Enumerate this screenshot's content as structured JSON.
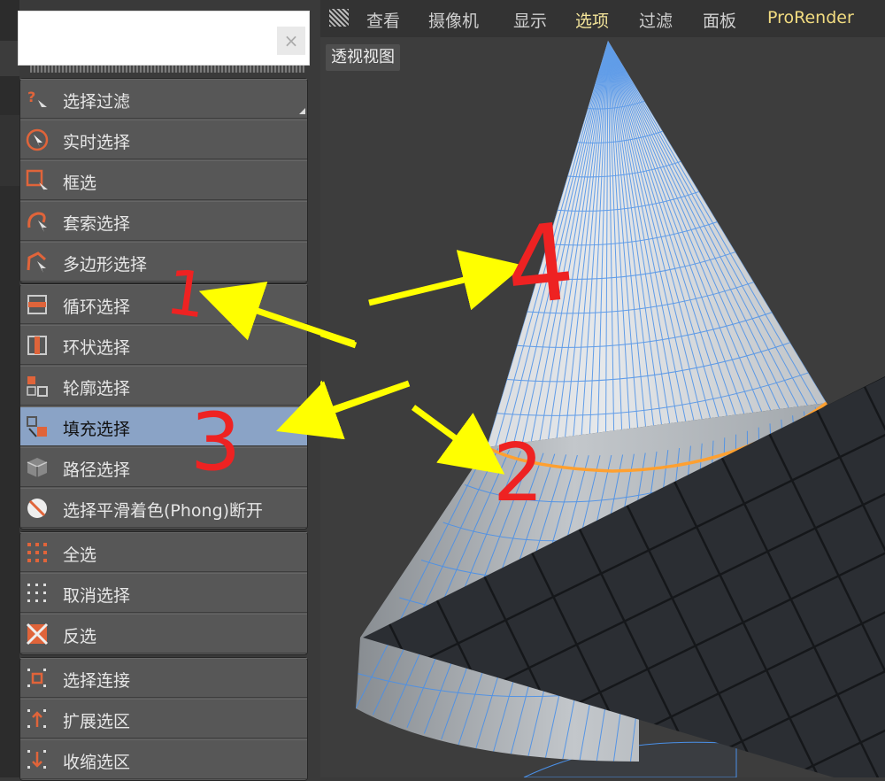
{
  "menu": {
    "groups": [
      {
        "items": [
          {
            "label": "选择过滤",
            "icon": "question-cursor-icon"
          },
          {
            "label": "实时选择",
            "icon": "live-select-icon"
          },
          {
            "label": "框选",
            "icon": "rectangle-select-icon"
          },
          {
            "label": "套索选择",
            "icon": "lasso-select-icon"
          },
          {
            "label": "多边形选择",
            "icon": "polygon-select-icon"
          }
        ]
      },
      {
        "items": [
          {
            "label": "循环选择",
            "icon": "loop-select-icon"
          },
          {
            "label": "环状选择",
            "icon": "ring-select-icon"
          },
          {
            "label": "轮廓选择",
            "icon": "outline-select-icon"
          },
          {
            "label": "填充选择",
            "icon": "fill-select-icon",
            "active": true
          },
          {
            "label": "路径选择",
            "icon": "path-select-icon"
          },
          {
            "label": "选择平滑着色(Phong)断开",
            "icon": "phong-break-icon"
          }
        ]
      },
      {
        "items": [
          {
            "label": "全选",
            "icon": "select-all-icon"
          },
          {
            "label": "取消选择",
            "icon": "deselect-icon"
          },
          {
            "label": "反选",
            "icon": "invert-select-icon"
          }
        ]
      },
      {
        "items": [
          {
            "label": "选择连接",
            "icon": "select-connected-icon"
          },
          {
            "label": "扩展选区",
            "icon": "grow-selection-icon"
          },
          {
            "label": "收缩选区",
            "icon": "shrink-selection-icon"
          }
        ]
      }
    ]
  },
  "search": {
    "close": "×"
  },
  "viewport": {
    "menubar": [
      "查看",
      "摄像机",
      "显示",
      "选项",
      "过滤",
      "面板",
      "ProRender"
    ],
    "selected_menu": "选项",
    "view_label": "透视视图"
  },
  "annotations": {
    "one": "1",
    "two": "2",
    "three": "3",
    "four": "4"
  },
  "colors": {
    "accent_selected": "#8aa3c6",
    "menu_highlight": "#f4e59a",
    "icon_orange": "#e0643a",
    "wire_blue": "#4a90e8",
    "annotation_red": "#ee2222",
    "annotation_arrow": "#ffff00",
    "edge_orange": "#ffa030"
  }
}
